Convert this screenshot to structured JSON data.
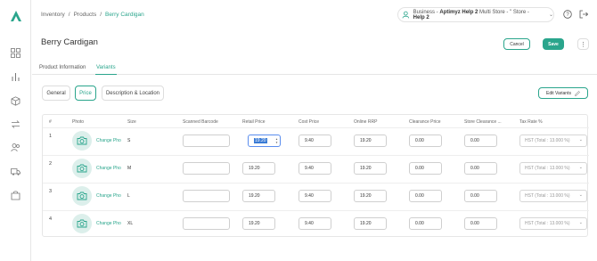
{
  "breadcrumb": {
    "items": [
      "Inventory",
      "Products",
      "Berry Cardigan"
    ]
  },
  "business": {
    "label": "Business - ",
    "name": "Aptimyz Help 2",
    "rest": " Multi Store - \" Store - ",
    "store": "Help 2"
  },
  "page": {
    "title": "Berry Cardigan",
    "cancel": "Cancel",
    "save": "Save"
  },
  "tabs": [
    "Product Information",
    "Variants"
  ],
  "subtabs": [
    "General",
    "Price",
    "Description & Location"
  ],
  "edit_variants": "Edit Variants",
  "table": {
    "headers": [
      "#",
      "Photo",
      "Size",
      "Scanned Barcode",
      "Retail Price",
      "Cost Price",
      "Online RRP",
      "Clearance Price",
      "Store Clearance ...",
      "Tax Rate %"
    ],
    "change_photo": "Change Pho",
    "rows": [
      {
        "num": "1",
        "size": "S",
        "barcode": "",
        "retail": "19.20",
        "cost": "9.40",
        "rrp": "19.20",
        "clearance": "0.00",
        "store_clearance": "0.00",
        "tax": "HST (Total : 13.000 %)"
      },
      {
        "num": "2",
        "size": "M",
        "barcode": "",
        "retail": "19.20",
        "cost": "9.40",
        "rrp": "19.20",
        "clearance": "0.00",
        "store_clearance": "0.00",
        "tax": "HST (Total : 13.000 %)"
      },
      {
        "num": "3",
        "size": "L",
        "barcode": "",
        "retail": "19.20",
        "cost": "9.40",
        "rrp": "19.20",
        "clearance": "0.00",
        "store_clearance": "0.00",
        "tax": "HST (Total : 13.000 %)"
      },
      {
        "num": "4",
        "size": "XL",
        "barcode": "",
        "retail": "19.20",
        "cost": "9.40",
        "rrp": "19.20",
        "clearance": "0.00",
        "store_clearance": "0.00",
        "tax": "HST (Total : 13.000 %)"
      }
    ]
  },
  "colors": {
    "accent": "#2aa58c",
    "selection": "#3a7bd5"
  },
  "icons": [
    "logo-icon",
    "dashboard-icon",
    "reports-icon",
    "box-icon",
    "transfer-icon",
    "users-icon",
    "truck-icon",
    "store-icon",
    "user-icon",
    "chevron-down-icon",
    "help-icon",
    "logout-icon",
    "pencil-icon",
    "camera-icon"
  ]
}
